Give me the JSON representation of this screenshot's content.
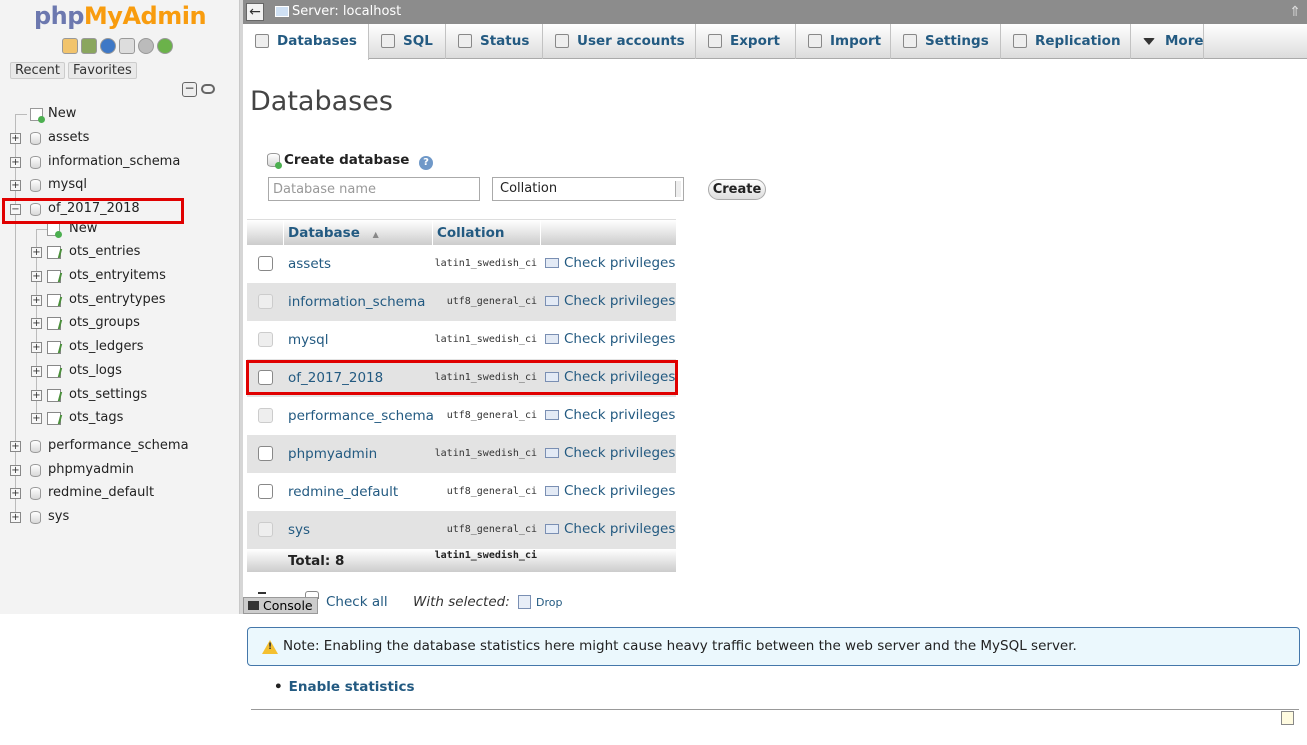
{
  "nav": {
    "logo_php": "php",
    "logo_myadmin": "MyAdmin",
    "icons": [
      "home-icon",
      "exit-icon",
      "help-icon",
      "docs-icon",
      "settings-icon",
      "reload-icon"
    ],
    "tab_recent": "Recent",
    "tab_favorites": "Favorites",
    "collapse_glyph": "−",
    "tree": [
      {
        "label": "New",
        "kind": "new"
      },
      {
        "label": "assets",
        "kind": "db"
      },
      {
        "label": "information_schema",
        "kind": "db"
      },
      {
        "label": "mysql",
        "kind": "db"
      },
      {
        "label": "of_2017_2018",
        "kind": "db",
        "expanded": true
      },
      {
        "label": "New",
        "kind": "new-table"
      },
      {
        "label": "ots_entries",
        "kind": "table"
      },
      {
        "label": "ots_entryitems",
        "kind": "table"
      },
      {
        "label": "ots_entrytypes",
        "kind": "table"
      },
      {
        "label": "ots_groups",
        "kind": "table"
      },
      {
        "label": "ots_ledgers",
        "kind": "table"
      },
      {
        "label": "ots_logs",
        "kind": "table"
      },
      {
        "label": "ots_settings",
        "kind": "table"
      },
      {
        "label": "ots_tags",
        "kind": "table"
      },
      {
        "label": "performance_schema",
        "kind": "db"
      },
      {
        "label": "phpmyadmin",
        "kind": "db"
      },
      {
        "label": "redmine_default",
        "kind": "db"
      },
      {
        "label": "sys",
        "kind": "db"
      }
    ]
  },
  "topbar": {
    "back_glyph": "←",
    "title": "Server: localhost",
    "up_glyph": "⇑"
  },
  "tabs": [
    {
      "label": "Databases",
      "icon": "database-icon",
      "active": true
    },
    {
      "label": "SQL",
      "icon": "sql-icon"
    },
    {
      "label": "Status",
      "icon": "status-icon"
    },
    {
      "label": "User accounts",
      "icon": "user-accounts-icon"
    },
    {
      "label": "Export",
      "icon": "export-icon"
    },
    {
      "label": "Import",
      "icon": "import-icon"
    },
    {
      "label": "Settings",
      "icon": "settings-icon"
    },
    {
      "label": "Replication",
      "icon": "replication-icon"
    },
    {
      "label": "More",
      "icon": "caret-down-icon"
    }
  ],
  "main": {
    "title": "Databases",
    "create": {
      "heading": "Create database",
      "help_glyph": "?",
      "name_placeholder": "Database name",
      "collation_value": "Collation",
      "button": "Create"
    },
    "table": {
      "col_database": "Database",
      "sort_glyph": "▲",
      "col_collation": "Collation",
      "rows": [
        {
          "name": "assets",
          "collation": "latin1_swedish_ci",
          "action": "Check privileges",
          "disabled": false
        },
        {
          "name": "information_schema",
          "collation": "utf8_general_ci",
          "action": "Check privileges",
          "disabled": true
        },
        {
          "name": "mysql",
          "collation": "latin1_swedish_ci",
          "action": "Check privileges",
          "disabled": true
        },
        {
          "name": "of_2017_2018",
          "collation": "latin1_swedish_ci",
          "action": "Check privileges",
          "disabled": false
        },
        {
          "name": "performance_schema",
          "collation": "utf8_general_ci",
          "action": "Check privileges",
          "disabled": true
        },
        {
          "name": "phpmyadmin",
          "collation": "latin1_swedish_ci",
          "action": "Check privileges",
          "disabled": false
        },
        {
          "name": "redmine_default",
          "collation": "utf8_general_ci",
          "action": "Check privileges",
          "disabled": false
        },
        {
          "name": "sys",
          "collation": "utf8_general_ci",
          "action": "Check privileges",
          "disabled": true
        }
      ],
      "total_label": "Total: 8",
      "total_collation": "latin1_swedish_ci"
    },
    "bulk": {
      "check_all": "Check all",
      "with_selected": "With selected:",
      "drop": "Drop"
    },
    "console": "Console",
    "note": "Note: Enabling the database statistics here might cause heavy traffic between the web server and the MySQL server.",
    "enable_stats_bullet": "•",
    "enable_stats": "Enable statistics"
  }
}
